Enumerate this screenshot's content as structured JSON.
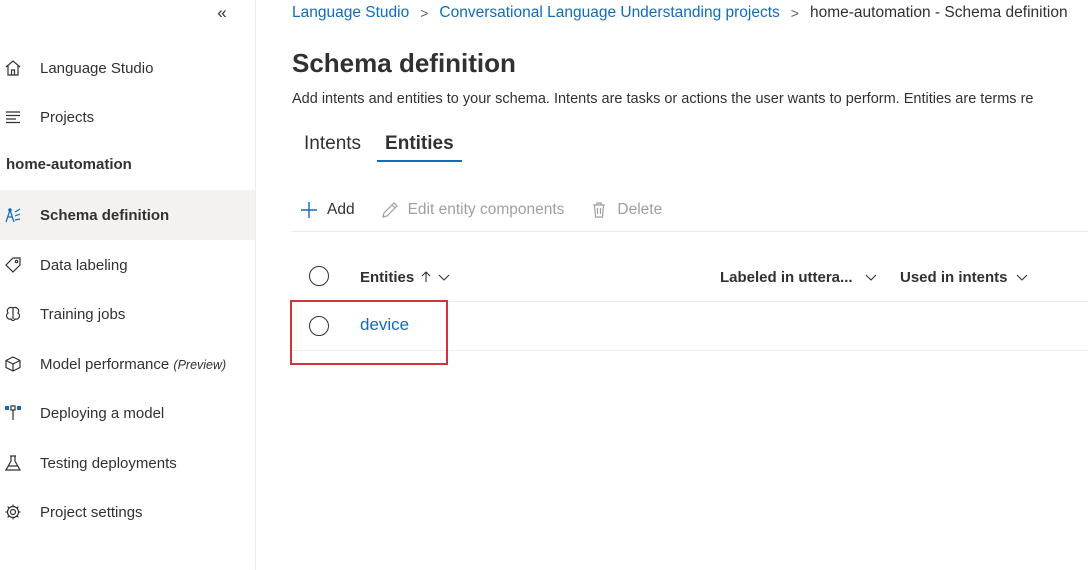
{
  "sidebar": {
    "collapse_glyph": "«",
    "project_name": "home-automation",
    "items": [
      {
        "label": "Language Studio",
        "icon": "home-icon"
      },
      {
        "label": "Projects",
        "icon": "list-icon"
      },
      {
        "label": "Schema definition",
        "icon": "schema-icon",
        "active": true
      },
      {
        "label": "Data labeling",
        "icon": "tag-icon"
      },
      {
        "label": "Training jobs",
        "icon": "brain-icon"
      },
      {
        "label": "Model performance",
        "suffix": "(Preview)",
        "icon": "cube-icon"
      },
      {
        "label": "Deploying a model",
        "icon": "deploy-icon"
      },
      {
        "label": "Testing deployments",
        "icon": "flask-icon"
      },
      {
        "label": "Project settings",
        "icon": "gear-icon"
      }
    ]
  },
  "breadcrumb": {
    "items": [
      "Language Studio",
      "Conversational Language Understanding projects"
    ],
    "current": "home-automation - Schema definition"
  },
  "page": {
    "title": "Schema definition",
    "description": "Add intents and entities to your schema. Intents are tasks or actions the user wants to perform. Entities are terms re"
  },
  "tabs": [
    {
      "label": "Intents",
      "active": false
    },
    {
      "label": "Entities",
      "active": true
    }
  ],
  "toolbar": {
    "add_label": "Add",
    "edit_label": "Edit entity components",
    "delete_label": "Delete"
  },
  "grid": {
    "columns": [
      "Entities",
      "Labeled in uttera...",
      "Used in intents"
    ],
    "rows": [
      {
        "entity": "device"
      }
    ]
  },
  "colors": {
    "accent": "#0f6cbd",
    "highlight": "#d13438",
    "active_bg": "#f3f2f1"
  }
}
